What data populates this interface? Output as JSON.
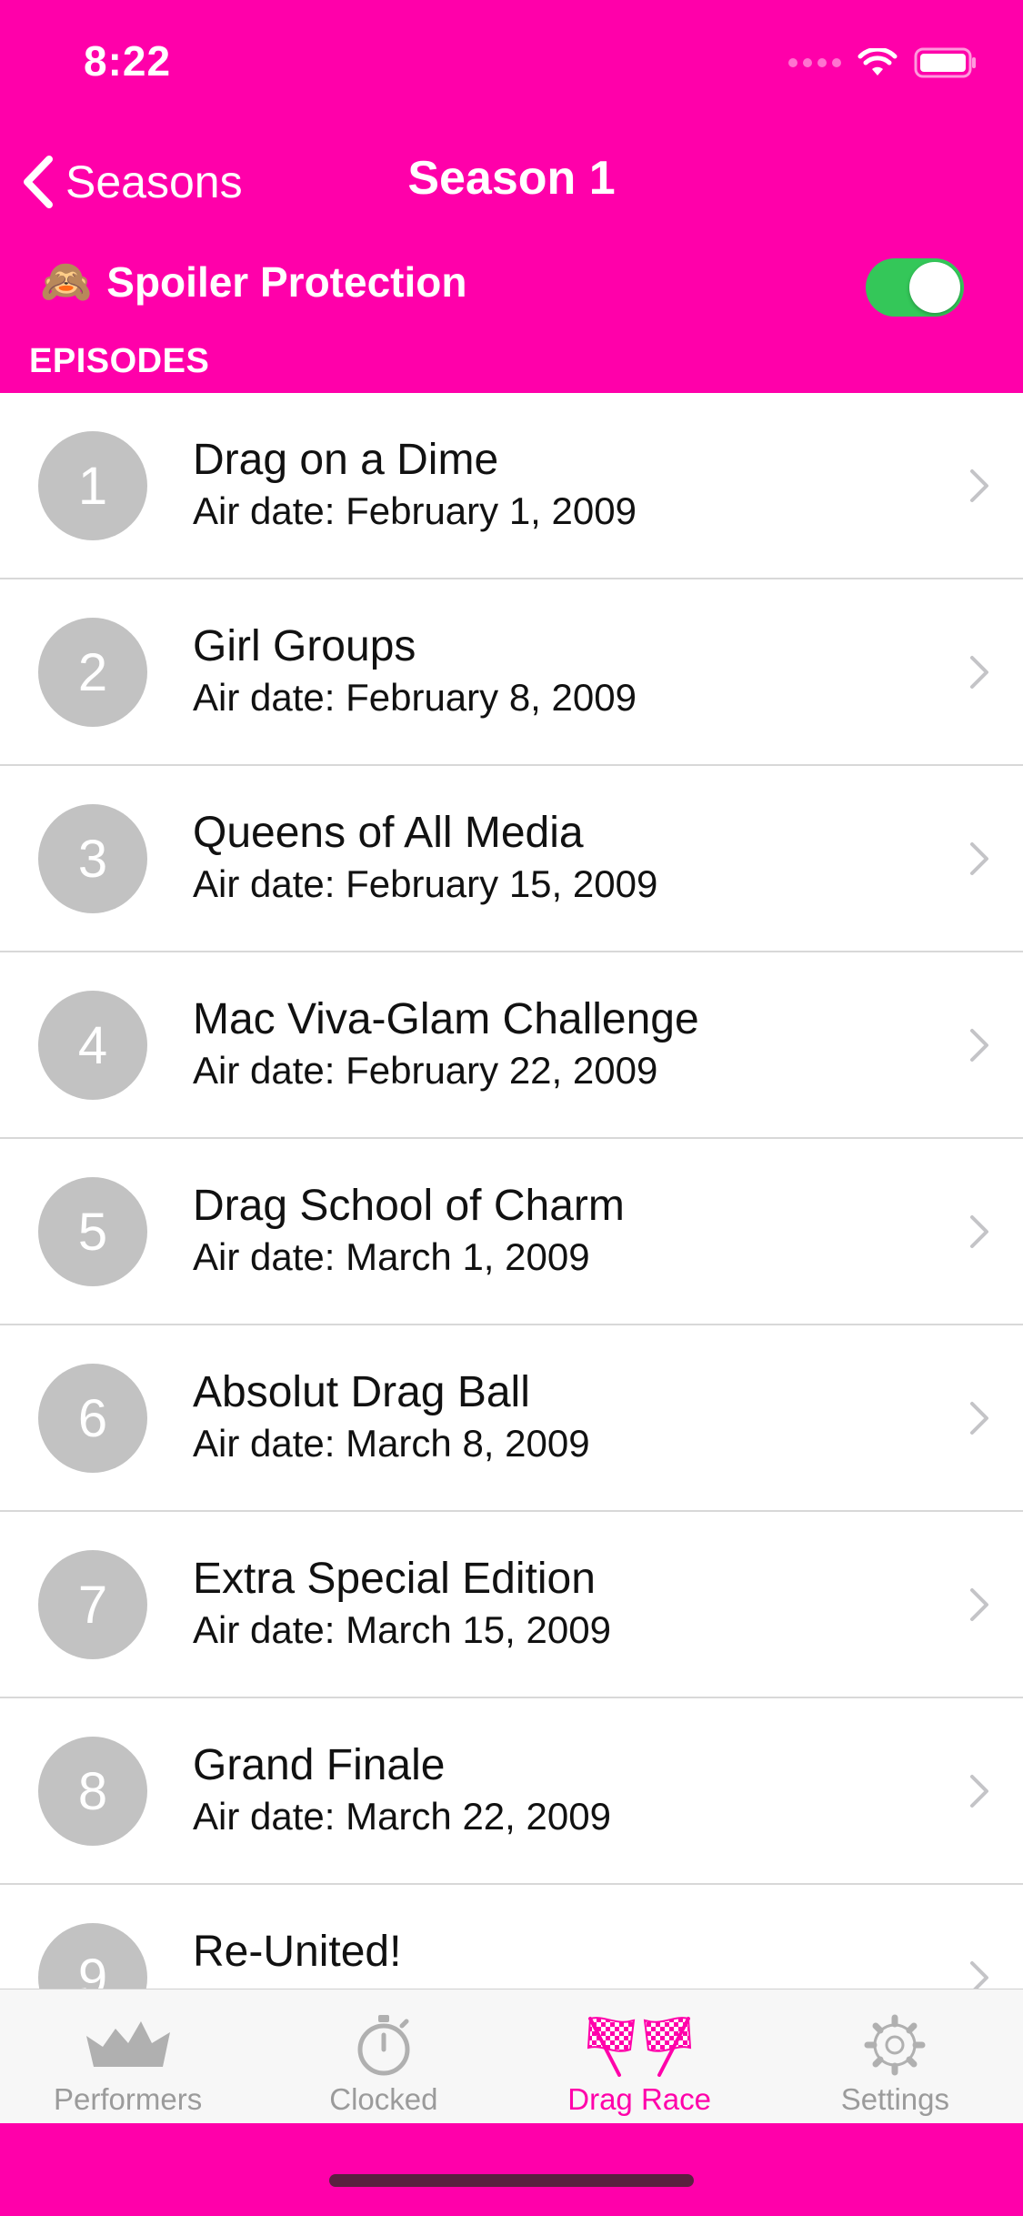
{
  "status_bar": {
    "time": "8:22"
  },
  "nav": {
    "back_label": "Seasons",
    "title": "Season 1"
  },
  "spoiler": {
    "emoji": "🙈",
    "label": "Spoiler Protection",
    "enabled": true
  },
  "section": {
    "header": "EPISODES"
  },
  "episodes": [
    {
      "number": "1",
      "title": "Drag on a Dime",
      "air_date": "Air date: February 1, 2009"
    },
    {
      "number": "2",
      "title": "Girl Groups",
      "air_date": "Air date: February 8, 2009"
    },
    {
      "number": "3",
      "title": "Queens of All Media",
      "air_date": "Air date: February 15, 2009"
    },
    {
      "number": "4",
      "title": "Mac Viva-Glam Challenge",
      "air_date": "Air date: February 22, 2009"
    },
    {
      "number": "5",
      "title": "Drag School of Charm",
      "air_date": "Air date: March 1, 2009"
    },
    {
      "number": "6",
      "title": "Absolut Drag Ball",
      "air_date": "Air date: March 8, 2009"
    },
    {
      "number": "7",
      "title": "Extra Special Edition",
      "air_date": "Air date: March 15, 2009"
    },
    {
      "number": "8",
      "title": "Grand Finale",
      "air_date": "Air date: March 22, 2009"
    },
    {
      "number": "9",
      "title": "Re-United!",
      "air_date": ""
    }
  ],
  "tabs": [
    {
      "label": "Performers",
      "icon": "crown-icon",
      "active": false
    },
    {
      "label": "Clocked",
      "icon": "stopwatch-icon",
      "active": false
    },
    {
      "label": "Drag Race",
      "icon": "checkered-flags-icon",
      "active": true
    },
    {
      "label": "Settings",
      "icon": "gear-icon",
      "active": false
    }
  ],
  "colors": {
    "accent": "#ff00aa",
    "toggle_on": "#34c759",
    "badge": "#c2c2c2",
    "tab_inactive": "#9b9b9b"
  }
}
